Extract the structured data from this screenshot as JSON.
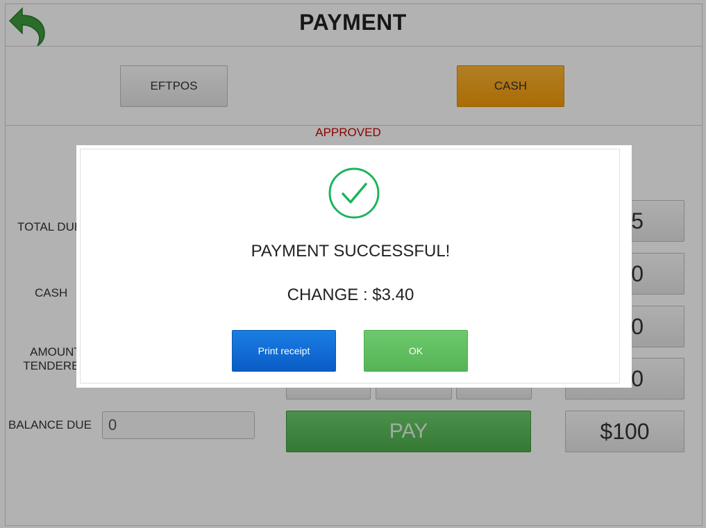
{
  "header": {
    "title": "PAYMENT",
    "back_icon": "back-arrow-icon"
  },
  "methods": {
    "eftpos_label": "EFTPOS",
    "cash_label": "CASH",
    "cash_color": "#f39b0a"
  },
  "status": {
    "approved_text": "APPROVED",
    "approved_color": "#cc0000"
  },
  "labels": {
    "total_due": "TOTAL DUE",
    "cash": "CASH",
    "amount_tendered_line1": "AMOUNT",
    "amount_tendered_line2": "TENDERED",
    "balance_due": "BALANCE DUE"
  },
  "balance_due_value": "0",
  "keypad": {
    "btn1_tail": "5",
    "btn2_tail": "0",
    "btn3_tail": "0",
    "btn4_tail": "0",
    "btn_100": "$100"
  },
  "pay_label": "PAY",
  "modal": {
    "icon": "check-circle-icon",
    "success_text": "PAYMENT SUCCESSFUL!",
    "change_text": "CHANGE : $3.40",
    "print_label": "Print receipt",
    "ok_label": "OK"
  }
}
